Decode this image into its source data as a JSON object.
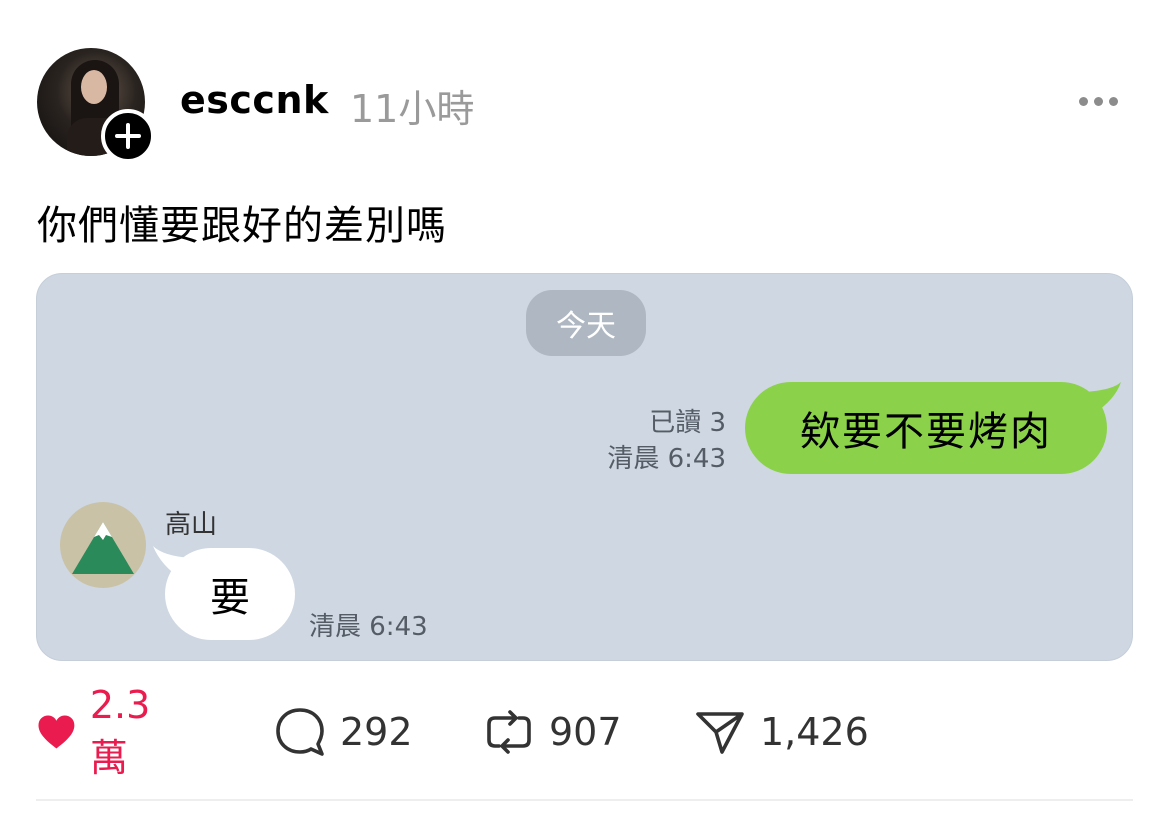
{
  "post": {
    "author": {
      "username": "esccnk",
      "time_ago": "11小時",
      "avatar_icon": "user-avatar",
      "follow_icon": "plus-icon"
    },
    "more_icon": "ellipsis-icon",
    "text": "你們懂要跟好的差別嗎"
  },
  "chat": {
    "date_label": "今天",
    "sent": {
      "text": "欸要不要烤肉",
      "read_label": "已讀 3",
      "time": "清晨 6:43",
      "bubble_color": "#8bd14a"
    },
    "received": {
      "sender_name": "高山",
      "text": "要",
      "time": "清晨 6:43",
      "avatar_icon": "mountain-icon"
    },
    "background_color": "#ced7e2"
  },
  "actions": {
    "likes": "2.3萬",
    "comments": "292",
    "reposts": "907",
    "shares": "1,426",
    "like_color": "#ea1b4e"
  }
}
